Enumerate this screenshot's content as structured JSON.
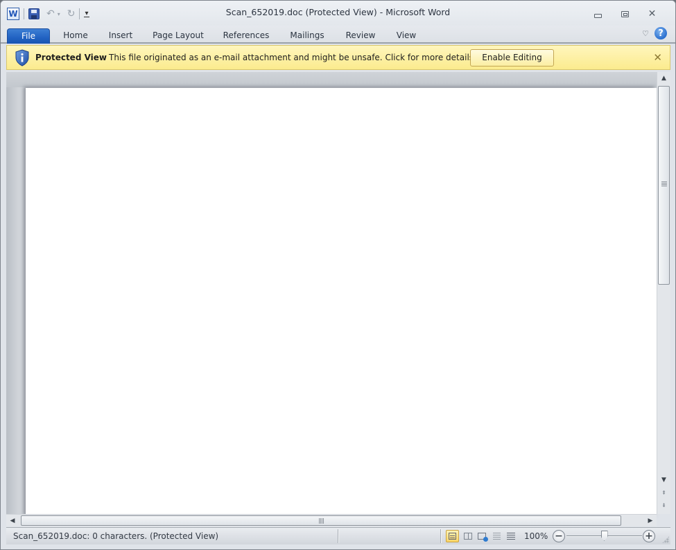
{
  "window": {
    "title": "Scan_652019.doc (Protected View)  -  Microsoft Word",
    "app_icon": "word-icon",
    "controls": [
      "minimize-icon",
      "maximize-icon",
      "close-icon"
    ]
  },
  "quick_access": {
    "items": [
      {
        "name": "save",
        "icon": "save-icon"
      },
      {
        "name": "undo",
        "icon": "undo-icon",
        "glyph": "↶"
      },
      {
        "name": "undo-dropdown",
        "glyph": "▾"
      },
      {
        "name": "redo",
        "icon": "redo-icon",
        "glyph": "↻"
      },
      {
        "name": "customize",
        "glyph": "▾"
      }
    ]
  },
  "ribbon": {
    "tabs": [
      {
        "label": "File",
        "active": true
      },
      {
        "label": "Home"
      },
      {
        "label": "Insert"
      },
      {
        "label": "Page Layout"
      },
      {
        "label": "References"
      },
      {
        "label": "Mailings"
      },
      {
        "label": "Review"
      },
      {
        "label": "View"
      }
    ],
    "minimize_glyph": "♡",
    "help_glyph": "?"
  },
  "protected_view": {
    "title": "Protected View",
    "message": "This file originated as an e-mail attachment and might be unsafe. Click for more details.",
    "enable_button": "Enable Editing",
    "close_glyph": "✕",
    "shield_glyph": "i",
    "bar_color": "#fcef9f"
  },
  "document": {
    "content": ""
  },
  "scrollbars": {
    "up_glyph": "▲",
    "down_glyph": "▼",
    "left_glyph": "◀",
    "right_glyph": "▶",
    "prev_page_glyph": "⇞",
    "next_page_glyph": "⇟"
  },
  "statusbar": {
    "text": "Scan_652019.doc: 0 characters.  (Protected View)",
    "zoom_level": "100%",
    "zoom_out_glyph": "−",
    "zoom_in_glyph": "+",
    "zoom_percent": 100,
    "views": [
      {
        "name": "print-layout",
        "active": true
      },
      {
        "name": "full-screen-reading",
        "active": false
      },
      {
        "name": "web-layout",
        "active": false
      },
      {
        "name": "outline",
        "active": false
      },
      {
        "name": "draft",
        "active": false
      }
    ]
  }
}
